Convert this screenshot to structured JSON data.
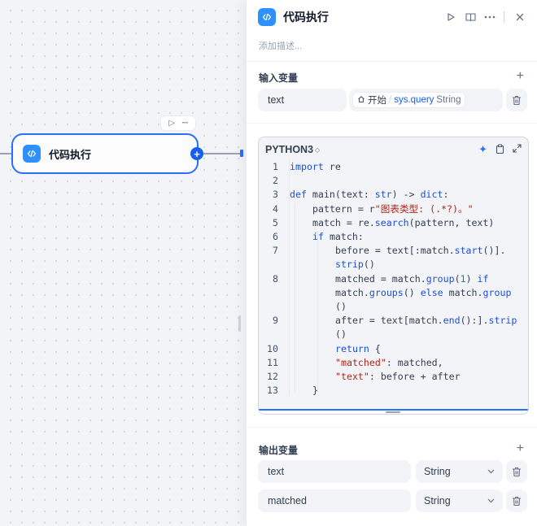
{
  "canvas": {
    "node": {
      "title": "代码执行",
      "icon": "code-icon",
      "add_symbol": "+"
    },
    "toolbar": {
      "run_icon": "▷",
      "more_icon": "···"
    }
  },
  "panel": {
    "title": "代码执行",
    "icon": "code-icon",
    "description_placeholder": "添加描述...",
    "header_actions": [
      "run-icon",
      "help-doc-icon",
      "more-icon",
      "close-icon"
    ],
    "input_section": {
      "title": "输入变量",
      "variables": [
        {
          "name": "text",
          "ref": {
            "node": "开始",
            "separator": "/",
            "variable": "sys.query",
            "type": "String"
          }
        }
      ]
    },
    "code_editor": {
      "language": "PYTHON3",
      "lines": [
        {
          "n": "1",
          "indent": 0,
          "tokens": [
            [
              "kw",
              "import"
            ],
            [
              "op",
              " re"
            ]
          ]
        },
        {
          "n": "2",
          "indent": 0,
          "tokens": []
        },
        {
          "n": "3",
          "indent": 0,
          "tokens": [
            [
              "kw",
              "def"
            ],
            [
              "op",
              " main(text: "
            ],
            [
              "ty",
              "str"
            ],
            [
              "op",
              ") -> "
            ],
            [
              "ty",
              "dict"
            ],
            [
              "op",
              ":"
            ]
          ]
        },
        {
          "n": "4",
          "indent": 1,
          "tokens": [
            [
              "op",
              "pattern = r"
            ],
            [
              "st",
              "\"图表类型: (.*?)。\""
            ]
          ]
        },
        {
          "n": "5",
          "indent": 1,
          "tokens": [
            [
              "op",
              "match = re."
            ],
            [
              "fn",
              "search"
            ],
            [
              "op",
              "(pattern, text)"
            ]
          ]
        },
        {
          "n": "6",
          "indent": 1,
          "tokens": [
            [
              "kw",
              "if"
            ],
            [
              "op",
              " match:"
            ]
          ]
        },
        {
          "n": "7",
          "indent": 2,
          "tokens": [
            [
              "op",
              "before = text[:match."
            ],
            [
              "fn",
              "start"
            ],
            [
              "op",
              "()]."
            ]
          ]
        },
        {
          "n": "",
          "indent": 2,
          "tokens": [
            [
              "fn",
              "strip"
            ],
            [
              "op",
              "()"
            ]
          ]
        },
        {
          "n": "8",
          "indent": 2,
          "tokens": [
            [
              "op",
              "matched = match."
            ],
            [
              "fn",
              "group"
            ],
            [
              "op",
              "("
            ],
            [
              "cn",
              "1"
            ],
            [
              "op",
              ") "
            ],
            [
              "kw",
              "if"
            ]
          ]
        },
        {
          "n": "",
          "indent": 2,
          "tokens": [
            [
              "op",
              "match."
            ],
            [
              "fn",
              "groups"
            ],
            [
              "op",
              "() "
            ],
            [
              "kw",
              "else"
            ],
            [
              "op",
              " match."
            ],
            [
              "fn",
              "group"
            ]
          ]
        },
        {
          "n": "",
          "indent": 2,
          "tokens": [
            [
              "op",
              "()"
            ]
          ]
        },
        {
          "n": "9",
          "indent": 2,
          "tokens": [
            [
              "op",
              "after = text[match."
            ],
            [
              "fn",
              "end"
            ],
            [
              "op",
              "():]."
            ],
            [
              "fn",
              "strip"
            ]
          ]
        },
        {
          "n": "",
          "indent": 2,
          "tokens": [
            [
              "op",
              "()"
            ]
          ]
        },
        {
          "n": "10",
          "indent": 2,
          "tokens": [
            [
              "kw",
              "return"
            ],
            [
              "op",
              " {"
            ]
          ]
        },
        {
          "n": "11",
          "indent": 2,
          "tokens": [
            [
              "st",
              "\"matched\""
            ],
            [
              "op",
              ": matched,"
            ]
          ]
        },
        {
          "n": "12",
          "indent": 2,
          "tokens": [
            [
              "st",
              "\"text\""
            ],
            [
              "op",
              ": before + after"
            ]
          ]
        },
        {
          "n": "13",
          "indent": 1,
          "tokens": [
            [
              "op",
              "}"
            ]
          ]
        }
      ]
    },
    "output_section": {
      "title": "输出变量",
      "variables": [
        {
          "name": "text",
          "type": "String"
        },
        {
          "name": "matched",
          "type": "String"
        }
      ]
    }
  }
}
